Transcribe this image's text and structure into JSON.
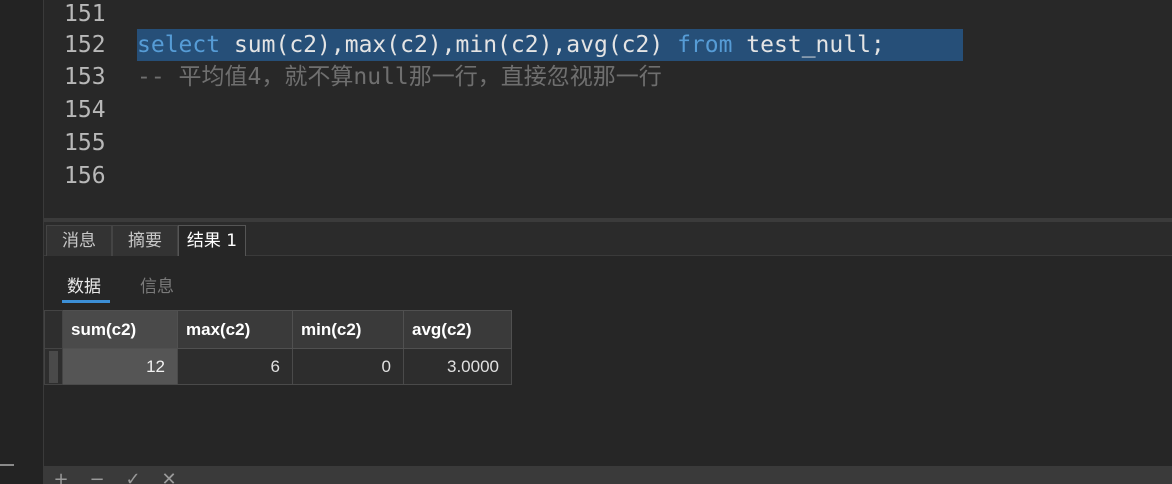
{
  "editor": {
    "lines": [
      {
        "number": "151",
        "parts": []
      },
      {
        "number": "152",
        "parts": [
          {
            "text": "select",
            "kind": "kw"
          },
          {
            "text": " sum(c2),max(c2),min(c2),avg(c2) ",
            "kind": "plain"
          },
          {
            "text": "from",
            "kind": "kw"
          },
          {
            "text": " test_null; ",
            "kind": "plain"
          }
        ]
      },
      {
        "number": "153",
        "parts": [
          {
            "text": "-- 平均值4，就不算null那一行，直接忽视那一行",
            "kind": "comment"
          }
        ]
      },
      {
        "number": "154",
        "parts": []
      },
      {
        "number": "155",
        "parts": []
      },
      {
        "number": "156",
        "parts": []
      }
    ],
    "selected_line": "152"
  },
  "result_tabs": [
    {
      "label": "消息",
      "active": false
    },
    {
      "label": "摘要",
      "active": false
    },
    {
      "label": "结果 1",
      "active": true
    }
  ],
  "sub_tabs": [
    {
      "label": "数据",
      "active": true
    },
    {
      "label": "信息",
      "active": false
    }
  ],
  "grid": {
    "columns": [
      "sum(c2)",
      "max(c2)",
      "min(c2)",
      "avg(c2)"
    ],
    "rows": [
      [
        "12",
        "6",
        "0",
        "3.0000"
      ]
    ],
    "selected_column": 0
  },
  "bottom_toolbar": [
    {
      "name": "add-row-icon",
      "glyph": "+"
    },
    {
      "name": "delete-row-icon",
      "glyph": "−"
    },
    {
      "name": "apply-icon",
      "glyph": "✓"
    },
    {
      "name": "discard-icon",
      "glyph": "✕"
    }
  ],
  "colors": {
    "keyword": "#569cd6",
    "selection": "#264f78",
    "comment": "#6f6f6f",
    "accent": "#3c8fd6"
  }
}
